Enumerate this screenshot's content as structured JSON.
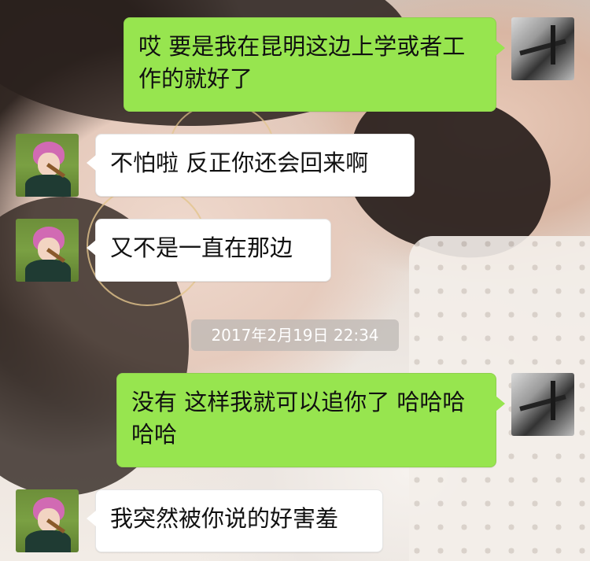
{
  "chat": {
    "messages": [
      {
        "sender": "me",
        "text": "哎 要是我在昆明这边上学或者工作的就好了"
      },
      {
        "sender": "friend",
        "text": "不怕啦 反正你还会回来啊"
      },
      {
        "sender": "friend",
        "text": "又不是一直在那边"
      },
      {
        "sender": "me",
        "text": "没有 这样我就可以追你了 哈哈哈哈哈"
      },
      {
        "sender": "friend",
        "text": "我突然被你说的好害羞"
      }
    ],
    "timestamp": "2017年2月19日 22:34"
  },
  "colors": {
    "me_bubble": "#97e54f",
    "friend_bubble": "#ffffff",
    "timestamp_bg": "#beb8b4"
  },
  "icons": {
    "me_avatar": "grayscale-pier-photo-avatar",
    "friend_avatar": "pink-hair-girl-avatar"
  }
}
